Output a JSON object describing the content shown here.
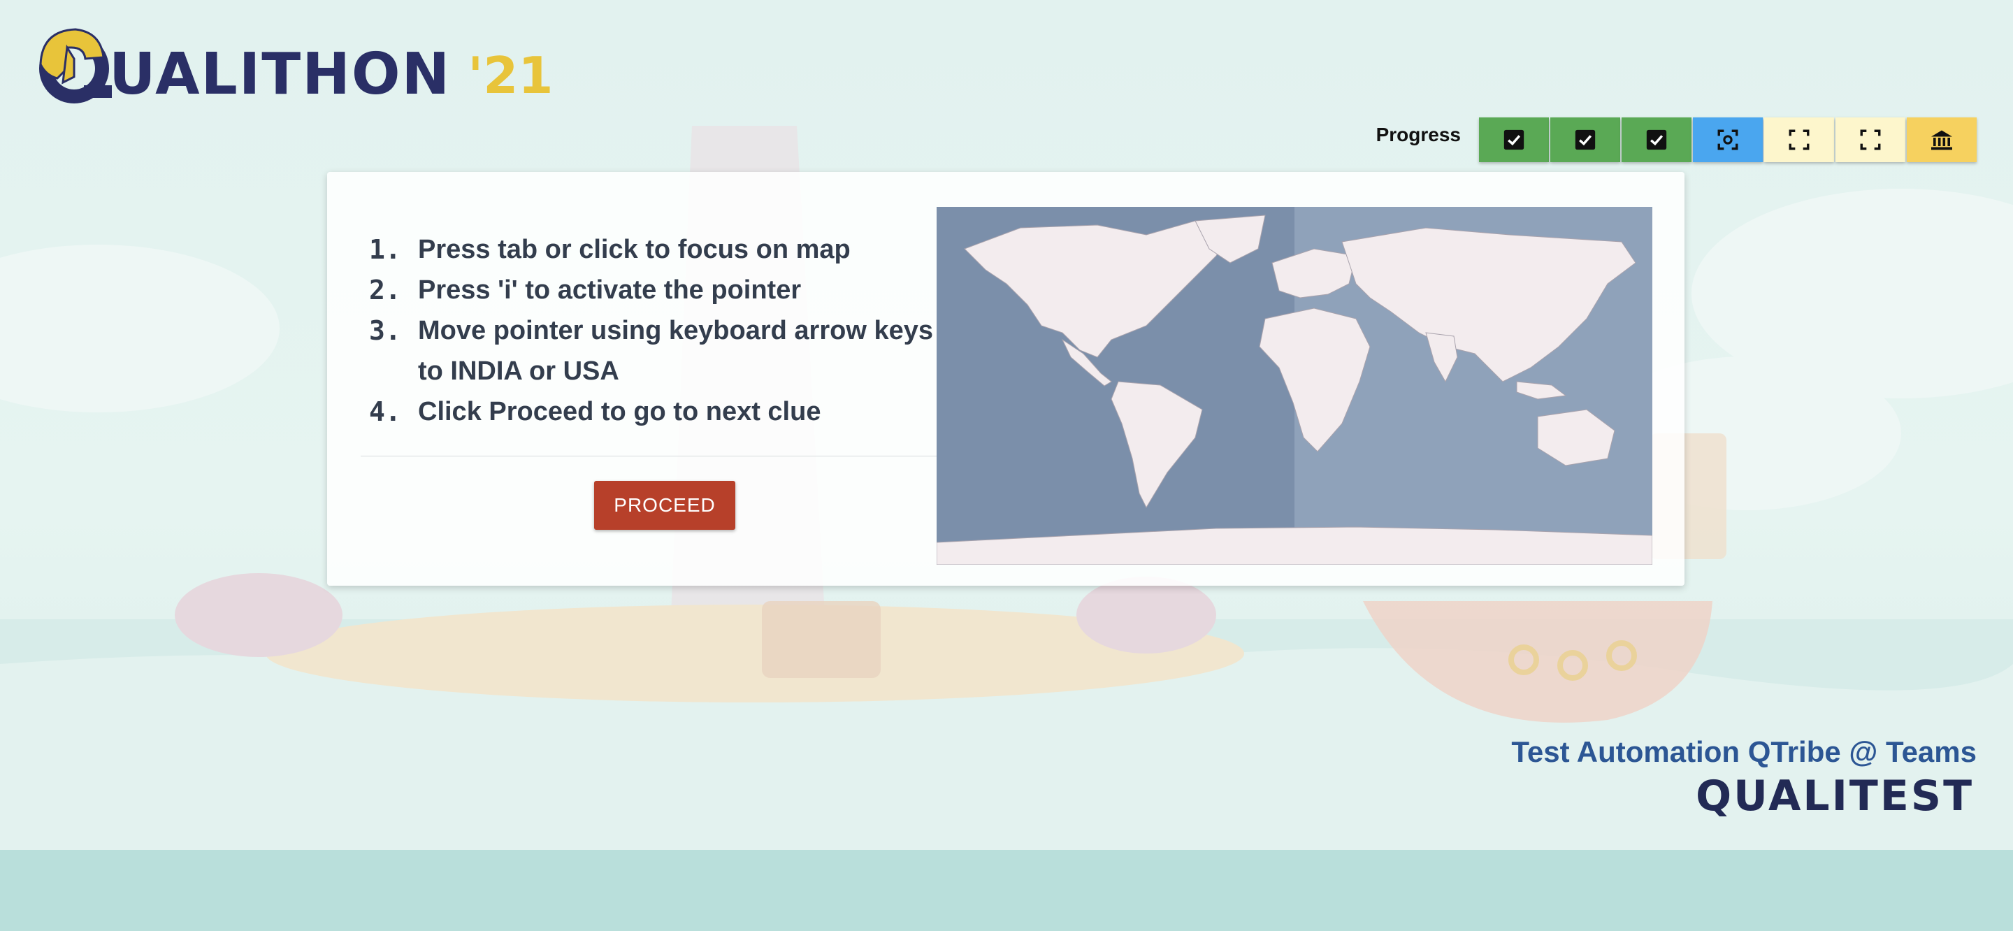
{
  "logo": {
    "mark": "Q",
    "name": "UALITHON",
    "year": "'21"
  },
  "progress": {
    "label": "Progress",
    "steps": [
      {
        "state": "done",
        "icon": "check-icon"
      },
      {
        "state": "done",
        "icon": "check-icon"
      },
      {
        "state": "done",
        "icon": "check-icon"
      },
      {
        "state": "current",
        "icon": "focus-target-icon"
      },
      {
        "state": "todo",
        "icon": "expand-frame-icon"
      },
      {
        "state": "todo",
        "icon": "expand-frame-icon"
      },
      {
        "state": "final",
        "icon": "bank-icon"
      }
    ],
    "colors": {
      "done": "#5aa955",
      "current": "#4aa6ef",
      "todo": "#fdf6cc",
      "final": "#f6d15f"
    }
  },
  "instructions": {
    "items": [
      {
        "num": "1.",
        "text": "Press tab or click to focus on map"
      },
      {
        "num": "2.",
        "text": "Press 'i' to activate the pointer"
      },
      {
        "num": "3.",
        "text": "Move pointer using keyboard arrow keys to INDIA or USA"
      },
      {
        "num": "4.",
        "text": "Click Proceed to go to next clue"
      }
    ]
  },
  "proceed_button": "PROCEED",
  "footer": {
    "tagline": "Test Automation QTribe @ Teams",
    "brand": "QUALITEST"
  },
  "colors": {
    "accent": "#b7402a",
    "brand_navy": "#2a2f66",
    "brand_yellow": "#e8c43a"
  }
}
